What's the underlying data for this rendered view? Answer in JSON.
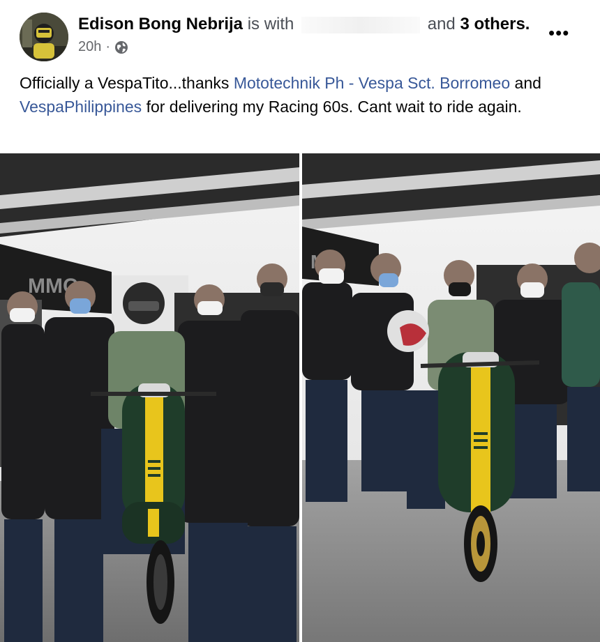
{
  "post": {
    "author": "Edison Bong Nebrija",
    "with_text": "is with",
    "and_text": "and",
    "others_text": "3 others.",
    "time": "20h",
    "dot": "·",
    "privacy_icon": "globe-icon",
    "more_icon": "more-horizontal-icon",
    "more_symbol": "•••"
  },
  "caption": {
    "part1": "Officially a VespaTito...thanks ",
    "link1": "Mototechnik Ph - Vespa Sct. Borromeo",
    "part2": " and ",
    "link2": "VespaPhilippines",
    "part3": " for delivering my Racing 60s. Cant wait to ride again."
  },
  "photos": {
    "left_banner": "MMC",
    "right_banner": "MM"
  },
  "colors": {
    "link": "#385898",
    "text": "#050505",
    "meta": "#65676b",
    "scooter_green": "#1f3d2a",
    "scooter_yellow": "#e8c51c"
  }
}
